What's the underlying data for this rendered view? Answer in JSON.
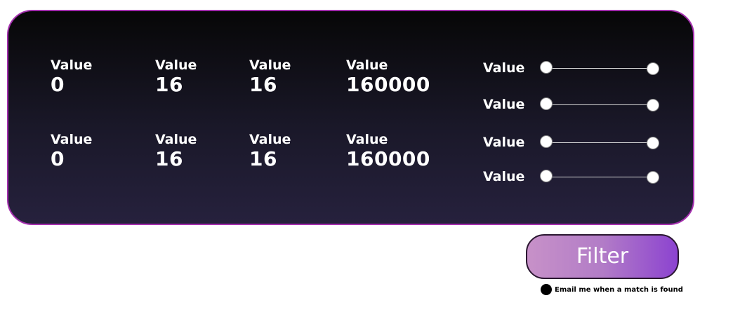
{
  "stats": {
    "row1": [
      {
        "label": "Value",
        "value": "0"
      },
      {
        "label": "Value",
        "value": "16"
      },
      {
        "label": "Value",
        "value": "16"
      },
      {
        "label": "Value",
        "value": "160000"
      }
    ],
    "row2": [
      {
        "label": "Value",
        "value": "0"
      },
      {
        "label": "Value",
        "value": "16"
      },
      {
        "label": "Value",
        "value": "16"
      },
      {
        "label": "Value",
        "value": "160000"
      }
    ]
  },
  "sliders": [
    {
      "label": "Value",
      "min_fraction": 0.0,
      "max_fraction": 1.0
    },
    {
      "label": "Value",
      "min_fraction": 0.0,
      "max_fraction": 1.0
    },
    {
      "label": "Value",
      "min_fraction": 0.0,
      "max_fraction": 1.0
    },
    {
      "label": "Value",
      "min_fraction": 0.0,
      "max_fraction": 1.0
    }
  ],
  "filter_button": {
    "label": "Filter"
  },
  "email_option": {
    "label": "Email me when a match is found"
  },
  "colors": {
    "panel_border": "#a42fae",
    "button_gradient_start": "#c791c8",
    "button_gradient_end": "#8c43d0"
  }
}
